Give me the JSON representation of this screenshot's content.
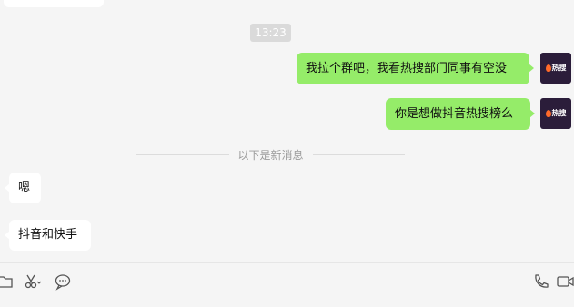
{
  "chat": {
    "timestamp": "13:23",
    "messages": [
      {
        "direction": "outgoing",
        "text": "我拉个群吧，我看热搜部门同事有空没"
      },
      {
        "direction": "outgoing",
        "text": "你是想做抖音热搜榜么"
      },
      {
        "direction": "incoming",
        "text": "嗯"
      },
      {
        "direction": "incoming",
        "text": "抖音和快手"
      }
    ],
    "new_messages_divider": "以下是新消息",
    "avatar_logo_text": "热搜"
  },
  "toolbar": {
    "icons": [
      "folder-icon",
      "scissors-icon",
      "chat-bubble-icon",
      "phone-icon",
      "video-icon"
    ]
  },
  "colors": {
    "outgoing_bubble": "#95ec69",
    "incoming_bubble": "#ffffff",
    "background": "#f5f5f5",
    "avatar_bg": "#2b1d3a"
  }
}
